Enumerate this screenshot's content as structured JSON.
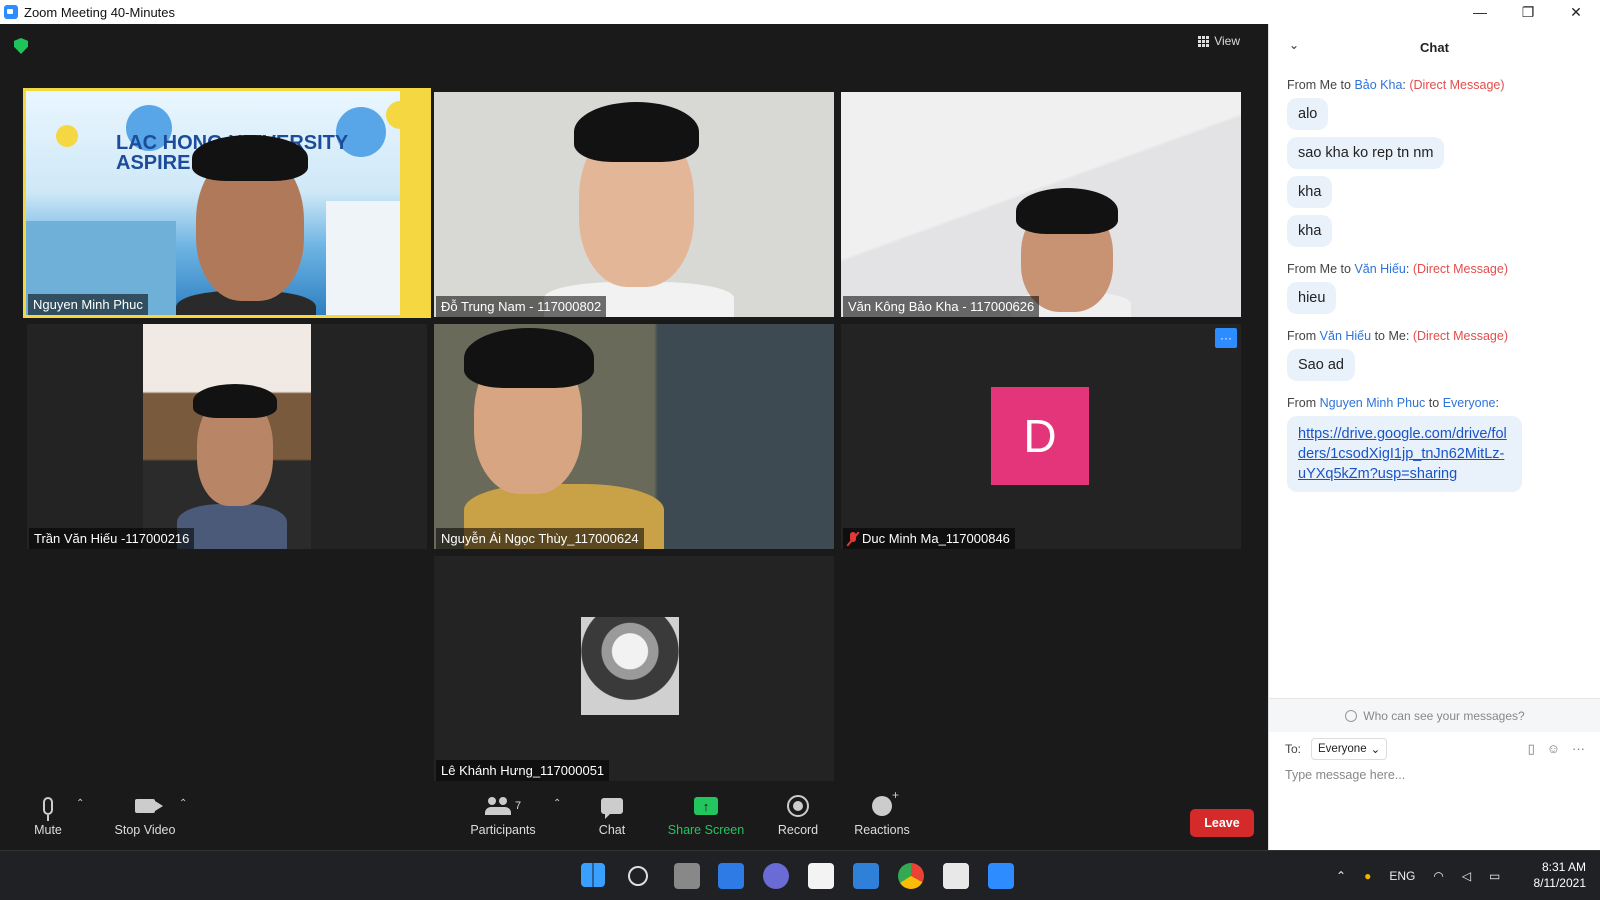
{
  "window": {
    "title": "Zoom Meeting 40-Minutes",
    "controls": [
      "—",
      "❐",
      "✕"
    ]
  },
  "meeting": {
    "view_label": "View",
    "banner_text": "LAC HONG UNIVERSITY ASPIRE",
    "participants": [
      {
        "name": "Nguyen Minh Phuc",
        "active_speaker": true
      },
      {
        "name": "Đỗ Trung Nam - 117000802"
      },
      {
        "name": "Văn Kông Bảo Kha - 117000626"
      },
      {
        "name": "Trần Văn Hiếu -117000216"
      },
      {
        "name": "Nguyễn Ái Ngọc Thùy_117000624"
      },
      {
        "name": "Duc Minh Ma_117000846",
        "avatar_letter": "D",
        "avatar_color": "#e4357b",
        "muted": true
      },
      {
        "name": "Lê Khánh Hưng_117000051"
      }
    ],
    "more_button": "···"
  },
  "controls": {
    "mute": "Mute",
    "stop_video": "Stop Video",
    "participants": "Participants",
    "participants_count": "7",
    "chat": "Chat",
    "share_screen": "Share Screen",
    "record": "Record",
    "reactions": "Reactions",
    "leave": "Leave"
  },
  "chat": {
    "title": "Chat",
    "groups": [
      {
        "from": "Me",
        "to": "Bảo Kha",
        "dm": "(Direct Message)",
        "messages": [
          "alo",
          "sao kha ko rep tn nm",
          "kha",
          "kha"
        ]
      },
      {
        "from": "Me",
        "to": "Văn Hiếu",
        "dm": "(Direct Message)",
        "messages": [
          "hieu"
        ]
      },
      {
        "from": "Văn Hiếu",
        "to": "Me",
        "dm": "(Direct Message)",
        "messages": [
          "Sao ad"
        ]
      },
      {
        "from": "Nguyen Minh Phuc",
        "to": "Everyone",
        "link": "https://drive.google.com/drive/folders/1csodXigI1jp_tnJn62MitLz-uYXq5kZm?usp=sharing"
      }
    ],
    "from_word": "From",
    "to_word": "to",
    "who_can_see": "Who can see your messages?",
    "to_label": "To:",
    "to_value": "Everyone",
    "placeholder": "Type message here..."
  },
  "taskbar": {
    "language": "ENG",
    "time": "8:31 AM",
    "date": "8/11/2021"
  },
  "colors": {
    "accent": "#2d8cff",
    "leave": "#d42a2a",
    "share": "#22c55e",
    "active_border": "#f5d742"
  }
}
